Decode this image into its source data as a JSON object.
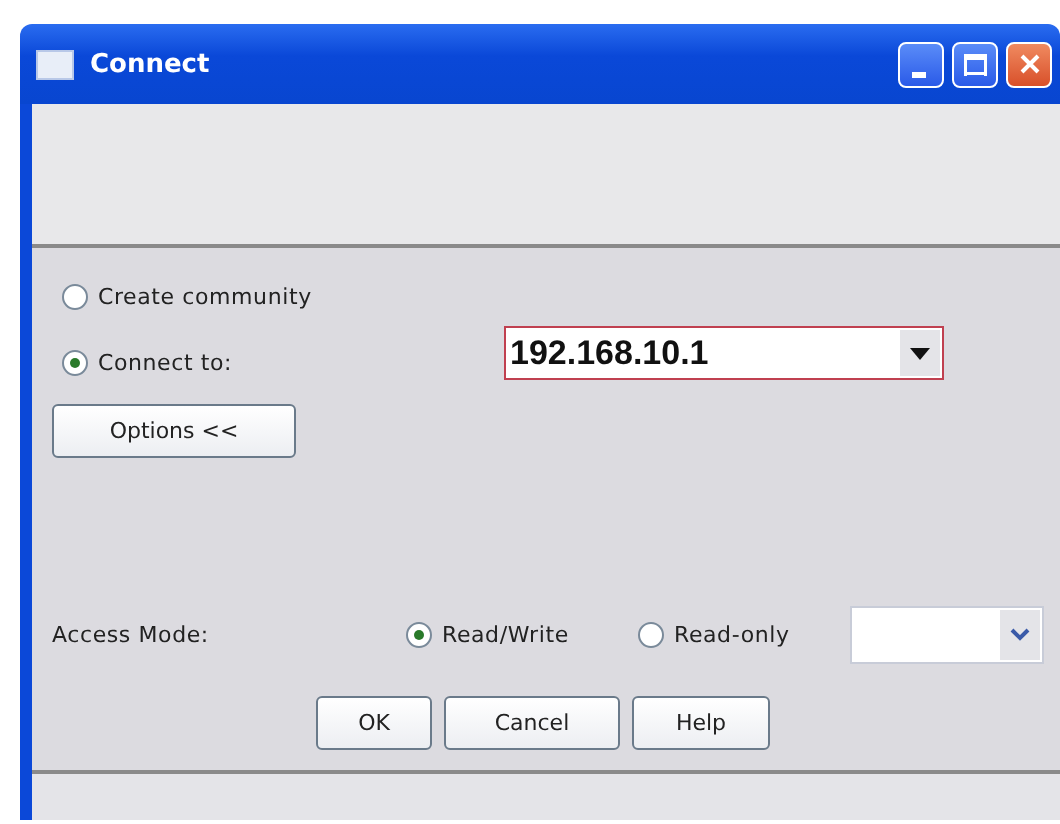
{
  "window": {
    "title": "Connect"
  },
  "connection_options": [
    {
      "label": "Create community",
      "selected": false
    },
    {
      "label": "Connect to:",
      "selected": true
    }
  ],
  "address": {
    "value": "192.168.10.1"
  },
  "options_button": "Options <<",
  "access_mode": {
    "label": "Access Mode:",
    "options": [
      {
        "label": "Read/Write",
        "selected": true
      },
      {
        "label": "Read-only",
        "selected": false
      }
    ]
  },
  "buttons": [
    "OK",
    "Cancel",
    "Help"
  ]
}
